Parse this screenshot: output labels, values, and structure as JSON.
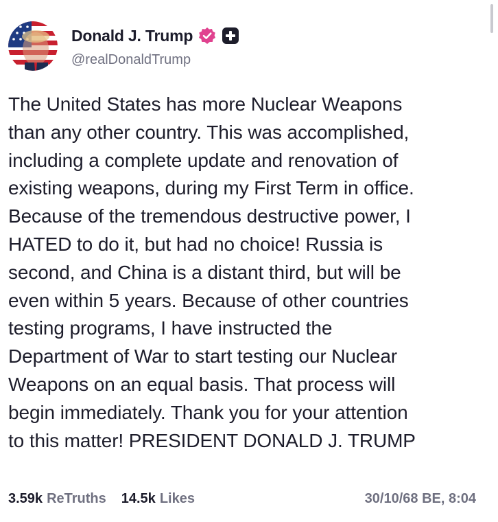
{
  "author": {
    "display_name": "Donald J. Trump",
    "handle": "@realDonaldTrump",
    "verified_icon": "verified-badge-icon",
    "follow_icon": "plus-icon"
  },
  "post": {
    "text": "The United States has more Nuclear Weapons\nthan any other country. This was accomplished,\nincluding a complete update and renovation of\nexisting weapons, during my First Term in office.\nBecause of the tremendous destructive power, I\nHATED to do it, but had no choice! Russia is\nsecond, and China is a distant third, but will be\neven within 5 years. Because of other countries\ntesting programs, I have instructed the\nDepartment of War to start testing our Nuclear\nWeapons on an equal basis. That process will\nbegin immediately. Thank you for your attention\nto this matter! PRESIDENT DONALD J. TRUMP"
  },
  "stats": {
    "retruths_count": "3.59k",
    "retruths_label": "ReTruths",
    "likes_count": "14.5k",
    "likes_label": "Likes",
    "timestamp": "30/10/68 BE, 8:04"
  },
  "colors": {
    "badge_pink": "#e0428f",
    "text_primary": "#1d1d2b",
    "text_secondary": "#6f7080"
  }
}
